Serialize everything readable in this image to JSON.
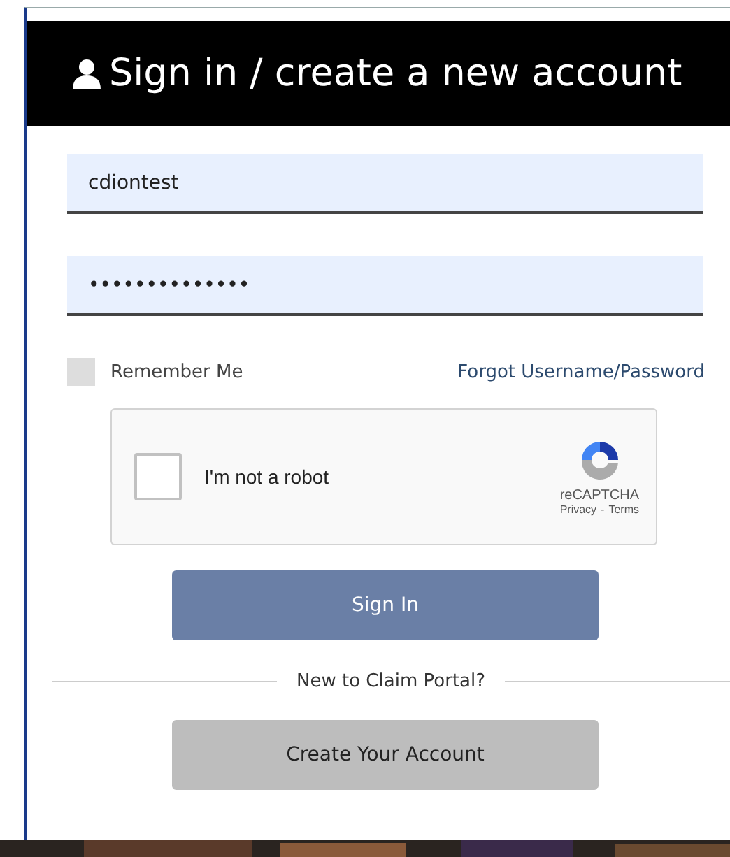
{
  "header": {
    "title": "Sign in / create a new account"
  },
  "username": {
    "value": "cdiontest"
  },
  "password": {
    "value": "••••••••••••••"
  },
  "remember": {
    "label": "Remember Me",
    "checked": false
  },
  "forgot_link": "Forgot Username/Password",
  "captcha": {
    "label": "I'm not a robot",
    "checked": false,
    "brand": "reCAPTCHA",
    "privacy": "Privacy",
    "separator": "-",
    "terms": "Terms"
  },
  "sign_in_button": "Sign In",
  "divider_text": "New to Claim Portal?",
  "create_button": "Create Your Account"
}
